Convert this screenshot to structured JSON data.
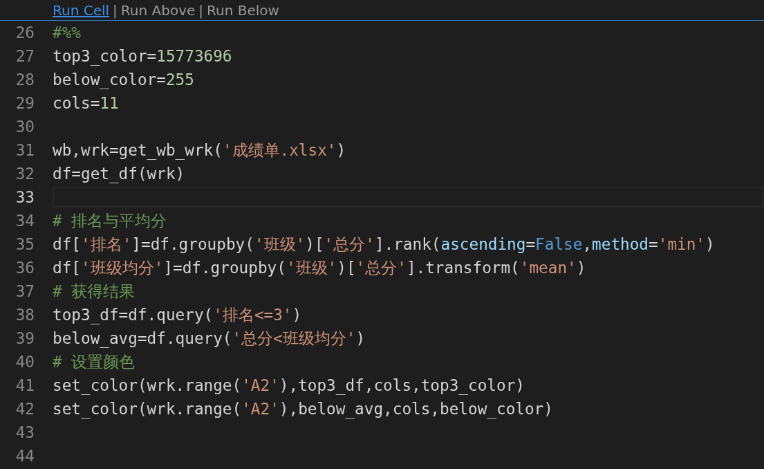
{
  "codelens": [
    {
      "label": "Run Cell",
      "kind": "link"
    },
    {
      "label": "|",
      "kind": "separator"
    },
    {
      "label": "Run Above",
      "kind": "action"
    },
    {
      "label": "|",
      "kind": "separator"
    },
    {
      "label": "Run Below",
      "kind": "action"
    }
  ],
  "lines": [
    {
      "number": "26",
      "current": false,
      "tokens": [
        {
          "kind": "comment",
          "text": "#%%"
        }
      ]
    },
    {
      "number": "27",
      "current": false,
      "tokens": [
        {
          "kind": "plain",
          "text": "top3_color="
        },
        {
          "kind": "number",
          "text": "15773696"
        }
      ]
    },
    {
      "number": "28",
      "current": false,
      "tokens": [
        {
          "kind": "plain",
          "text": "below_color="
        },
        {
          "kind": "number",
          "text": "255"
        }
      ]
    },
    {
      "number": "29",
      "current": false,
      "tokens": [
        {
          "kind": "plain",
          "text": "cols="
        },
        {
          "kind": "number",
          "text": "11"
        }
      ]
    },
    {
      "number": "30",
      "current": false
    },
    {
      "number": "31",
      "current": false,
      "tokens": [
        {
          "kind": "plain",
          "text": "wb,wrk=get_wb_wrk("
        },
        {
          "kind": "string",
          "text": "'成绩单.xlsx'"
        },
        {
          "kind": "plain",
          "text": ")"
        }
      ]
    },
    {
      "number": "32",
      "current": false,
      "tokens": [
        {
          "kind": "plain",
          "text": "df=get_df(wrk)"
        }
      ]
    },
    {
      "number": "33",
      "current": true
    },
    {
      "number": "34",
      "current": false,
      "tokens": [
        {
          "kind": "comment",
          "text": "# 排名与平均分"
        }
      ]
    },
    {
      "number": "35",
      "current": false,
      "tokens": [
        {
          "kind": "plain",
          "text": "df["
        },
        {
          "kind": "string",
          "text": "'排名'"
        },
        {
          "kind": "plain",
          "text": "]=df.groupby("
        },
        {
          "kind": "string",
          "text": "'班级'"
        },
        {
          "kind": "plain",
          "text": ")["
        },
        {
          "kind": "string",
          "text": "'总分'"
        },
        {
          "kind": "plain",
          "text": "].rank("
        },
        {
          "kind": "param",
          "text": "ascending"
        },
        {
          "kind": "plain",
          "text": "="
        },
        {
          "kind": "keyword",
          "text": "False"
        },
        {
          "kind": "plain",
          "text": ","
        },
        {
          "kind": "param",
          "text": "method"
        },
        {
          "kind": "plain",
          "text": "="
        },
        {
          "kind": "string",
          "text": "'min'"
        },
        {
          "kind": "plain",
          "text": ")"
        }
      ]
    },
    {
      "number": "36",
      "current": false,
      "tokens": [
        {
          "kind": "plain",
          "text": "df["
        },
        {
          "kind": "string",
          "text": "'班级均分'"
        },
        {
          "kind": "plain",
          "text": "]=df.groupby("
        },
        {
          "kind": "string",
          "text": "'班级'"
        },
        {
          "kind": "plain",
          "text": ")["
        },
        {
          "kind": "string",
          "text": "'总分'"
        },
        {
          "kind": "plain",
          "text": "].transform("
        },
        {
          "kind": "string",
          "text": "'mean'"
        },
        {
          "kind": "plain",
          "text": ")"
        }
      ]
    },
    {
      "number": "37",
      "current": false,
      "tokens": [
        {
          "kind": "comment",
          "text": "# 获得结果"
        }
      ]
    },
    {
      "number": "38",
      "current": false,
      "tokens": [
        {
          "kind": "plain",
          "text": "top3_df=df.query("
        },
        {
          "kind": "string",
          "text": "'排名<=3'"
        },
        {
          "kind": "plain",
          "text": ")"
        }
      ]
    },
    {
      "number": "39",
      "current": false,
      "tokens": [
        {
          "kind": "plain",
          "text": "below_avg=df.query("
        },
        {
          "kind": "string",
          "text": "'总分<班级均分'"
        },
        {
          "kind": "plain",
          "text": ")"
        }
      ]
    },
    {
      "number": "40",
      "current": false,
      "tokens": [
        {
          "kind": "comment",
          "text": "# 设置颜色"
        }
      ]
    },
    {
      "number": "41",
      "current": false,
      "tokens": [
        {
          "kind": "plain",
          "text": "set_color(wrk.range("
        },
        {
          "kind": "string",
          "text": "'A2'"
        },
        {
          "kind": "plain",
          "text": "),top3_df,cols,top3_color)"
        }
      ]
    },
    {
      "number": "42",
      "current": false,
      "tokens": [
        {
          "kind": "plain",
          "text": "set_color(wrk.range("
        },
        {
          "kind": "string",
          "text": "'A2'"
        },
        {
          "kind": "plain",
          "text": "),below_avg,cols,below_color)"
        }
      ]
    },
    {
      "number": "43",
      "current": false
    },
    {
      "number": "44",
      "current": false
    }
  ]
}
